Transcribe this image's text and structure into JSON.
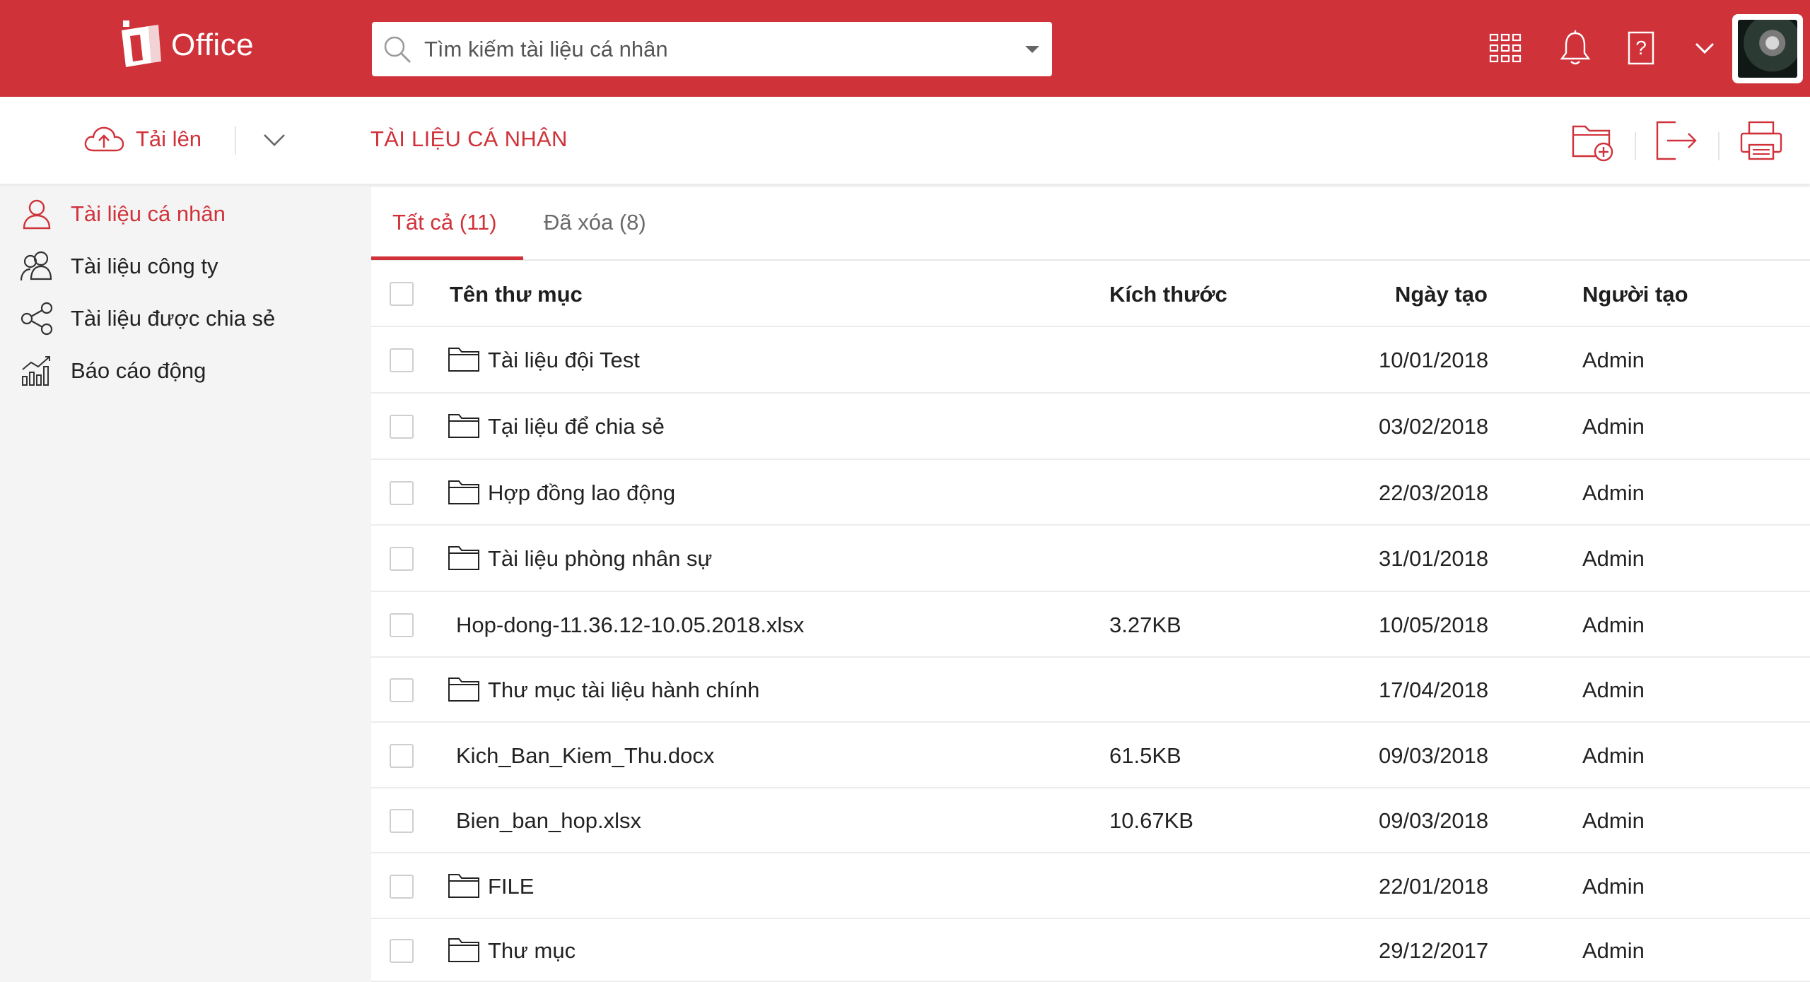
{
  "app": {
    "logo_text": "Office"
  },
  "search": {
    "placeholder": "Tìm kiếm tài liệu cá nhân"
  },
  "colors": {
    "brand_red": "#d0323a",
    "row_border": "#ececec",
    "sidebar_bg": "#f4f4f4"
  },
  "topbar": {
    "icons": [
      "apps-grid-icon",
      "bell-icon",
      "help-icon",
      "chevron-down-icon",
      "avatar"
    ]
  },
  "toolbar": {
    "upload_label": "Tải lên",
    "page_title": "TÀI LIỆU CÁ NHÂN",
    "actions": [
      "new-folder-icon",
      "export-icon",
      "print-icon"
    ]
  },
  "sidebar": {
    "items": [
      {
        "label": "Tài liệu cá nhân",
        "icon": "user-icon",
        "active": true
      },
      {
        "label": "Tài liệu công ty",
        "icon": "users-icon",
        "active": false
      },
      {
        "label": "Tài liệu được chia sẻ",
        "icon": "share-icon",
        "active": false
      },
      {
        "label": "Báo cáo động",
        "icon": "report-chart-icon",
        "active": false
      }
    ]
  },
  "tabs": [
    {
      "label": "Tất cả (11)",
      "active": true
    },
    {
      "label": "Đã xóa (8)",
      "active": false
    }
  ],
  "table": {
    "columns": {
      "name": "Tên thư mục",
      "size": "Kích thước",
      "created": "Ngày tạo",
      "creator": "Người tạo"
    },
    "rows": [
      {
        "type": "folder",
        "name": "Tài liệu đội Test",
        "size": "",
        "created": "10/01/2018",
        "creator": "Admin"
      },
      {
        "type": "folder",
        "name": "Tại liệu để chia sẻ",
        "size": "",
        "created": "03/02/2018",
        "creator": "Admin"
      },
      {
        "type": "folder",
        "name": "Hợp đồng lao động",
        "size": "",
        "created": "22/03/2018",
        "creator": "Admin"
      },
      {
        "type": "folder",
        "name": "Tài liệu phòng nhân sự",
        "size": "",
        "created": "31/01/2018",
        "creator": "Admin"
      },
      {
        "type": "file",
        "name": "Hop-dong-11.36.12-10.05.2018.xlsx",
        "size": "3.27KB",
        "created": "10/05/2018",
        "creator": "Admin"
      },
      {
        "type": "folder",
        "name": "Thư mục tài liệu hành chính",
        "size": "",
        "created": "17/04/2018",
        "creator": "Admin"
      },
      {
        "type": "file",
        "name": "Kich_Ban_Kiem_Thu.docx",
        "size": "61.5KB",
        "created": "09/03/2018",
        "creator": "Admin"
      },
      {
        "type": "file",
        "name": "Bien_ban_hop.xlsx",
        "size": "10.67KB",
        "created": "09/03/2018",
        "creator": "Admin"
      },
      {
        "type": "folder",
        "name": "FILE",
        "size": "",
        "created": "22/01/2018",
        "creator": "Admin"
      },
      {
        "type": "folder",
        "name": "Thư mục",
        "size": "",
        "created": "29/12/2017",
        "creator": "Admin"
      }
    ]
  }
}
